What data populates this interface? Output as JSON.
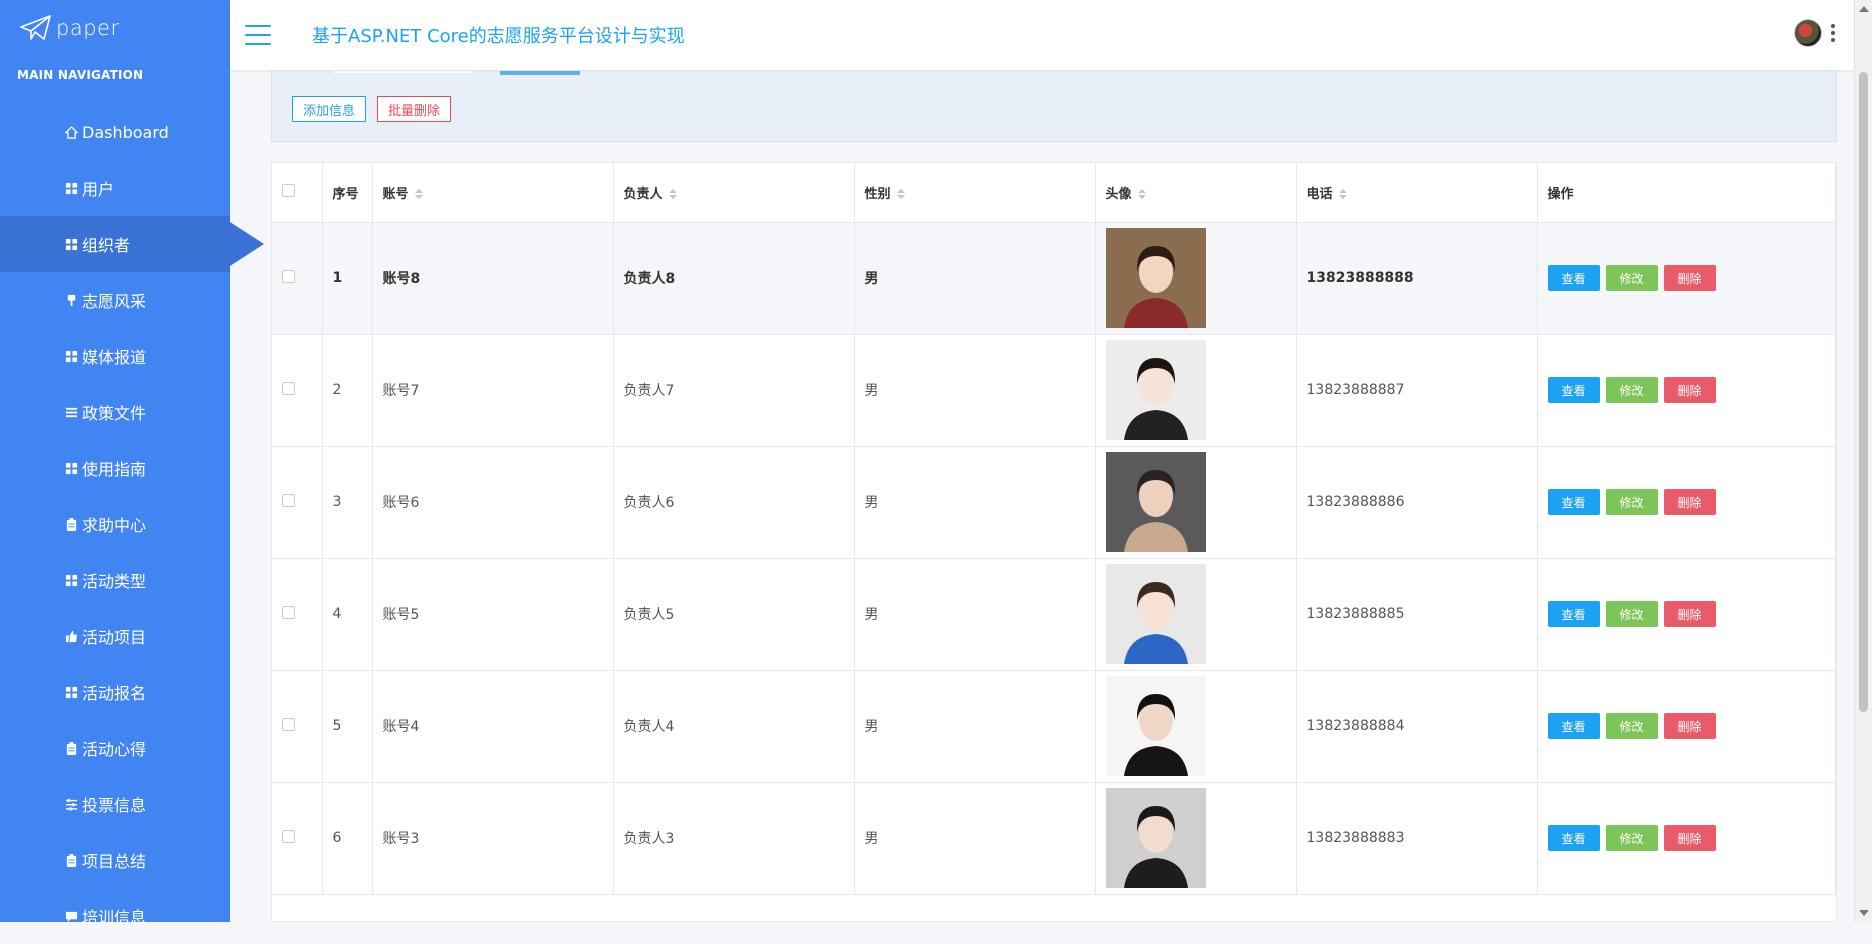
{
  "brand": {
    "name": "paper",
    "logo_icon": "paper-plane-icon"
  },
  "nav": {
    "header": "MAIN NAVIGATION",
    "items": [
      {
        "label": "Dashboard",
        "icon": "home-icon"
      },
      {
        "label": "用户",
        "icon": "grid-icon"
      },
      {
        "label": "组织者",
        "icon": "grid-icon",
        "active": true
      },
      {
        "label": "志愿风采",
        "icon": "brush-icon"
      },
      {
        "label": "媒体报道",
        "icon": "grid-icon"
      },
      {
        "label": "政策文件",
        "icon": "list-icon"
      },
      {
        "label": "使用指南",
        "icon": "grid-icon"
      },
      {
        "label": "求助中心",
        "icon": "clipboard-icon"
      },
      {
        "label": "活动类型",
        "icon": "grid-icon"
      },
      {
        "label": "活动项目",
        "icon": "thumbs-up-icon"
      },
      {
        "label": "活动报名",
        "icon": "grid-icon"
      },
      {
        "label": "活动心得",
        "icon": "clipboard-icon"
      },
      {
        "label": "投票信息",
        "icon": "sliders-icon"
      },
      {
        "label": "项目总结",
        "icon": "clipboard-icon"
      },
      {
        "label": "培训信息",
        "icon": "comment-icon"
      }
    ]
  },
  "header": {
    "title": "基于ASP.NET Core的志愿服务平台设计与实现"
  },
  "toolbar": {
    "add_label": "添加信息",
    "batch_delete_label": "批量删除"
  },
  "table": {
    "columns": [
      "序号",
      "账号",
      "负责人",
      "性别",
      "头像",
      "电话",
      "操作"
    ],
    "actions": {
      "view": "查看",
      "edit": "修改",
      "delete": "删除"
    },
    "rows": [
      {
        "index": "1",
        "account": "账号8",
        "manager": "负责人8",
        "gender": "男",
        "phone": "13823888888"
      },
      {
        "index": "2",
        "account": "账号7",
        "manager": "负责人7",
        "gender": "男",
        "phone": "13823888887"
      },
      {
        "index": "3",
        "account": "账号6",
        "manager": "负责人6",
        "gender": "男",
        "phone": "13823888886"
      },
      {
        "index": "4",
        "account": "账号5",
        "manager": "负责人5",
        "gender": "男",
        "phone": "13823888885"
      },
      {
        "index": "5",
        "account": "账号4",
        "manager": "负责人4",
        "gender": "男",
        "phone": "13823888884"
      },
      {
        "index": "6",
        "account": "账号3",
        "manager": "负责人3",
        "gender": "男",
        "phone": "13823888883"
      }
    ]
  },
  "colors": {
    "sidebar": "#4185f3",
    "sidebar_active": "#3a73d5",
    "accent": "#1da1f2",
    "edit": "#7dc459",
    "delete": "#ea5b6a"
  }
}
